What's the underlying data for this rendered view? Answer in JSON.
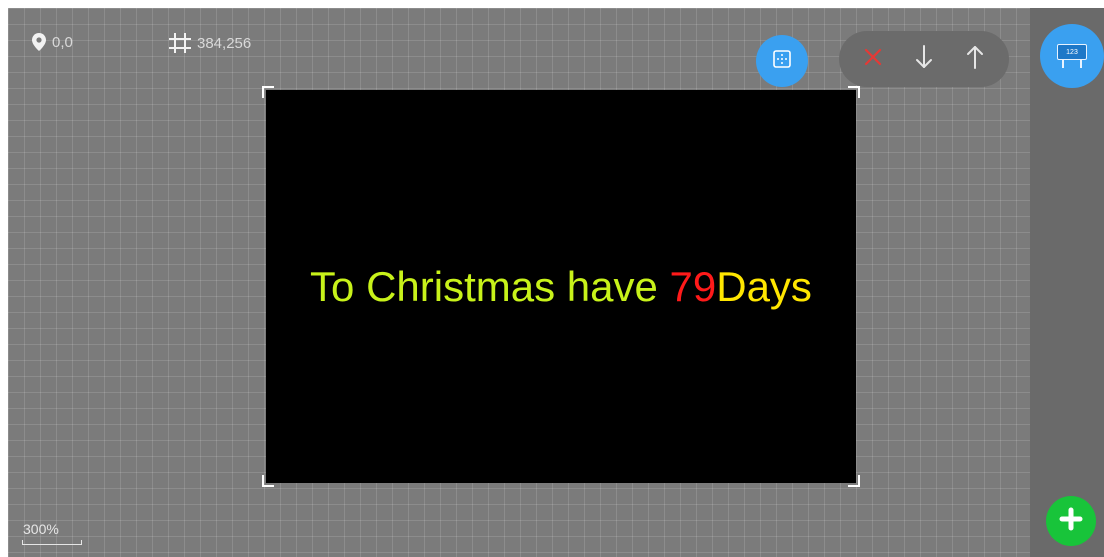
{
  "status": {
    "position_readout": "0,0",
    "size_readout": "384,256"
  },
  "canvas": {
    "message_prefix": "To Christmas have ",
    "message_number": "79",
    "message_suffix": "Days",
    "colors": {
      "prefix": "#c8f21a",
      "number": "#ff1a1a",
      "suffix": "#ffe600",
      "background": "#000000"
    }
  },
  "toolbar": {
    "align_icon": "align-grid-icon",
    "delete_icon": "close-icon",
    "move_down_icon": "arrow-down-icon",
    "move_up_icon": "arrow-up-icon",
    "delete_color": "#e53935"
  },
  "fab": {
    "counter_icon_label": "123",
    "add_icon": "plus-icon",
    "add_color": "#18c43a",
    "accent": "#3aa0f0"
  },
  "zoom": {
    "level": "300%"
  }
}
